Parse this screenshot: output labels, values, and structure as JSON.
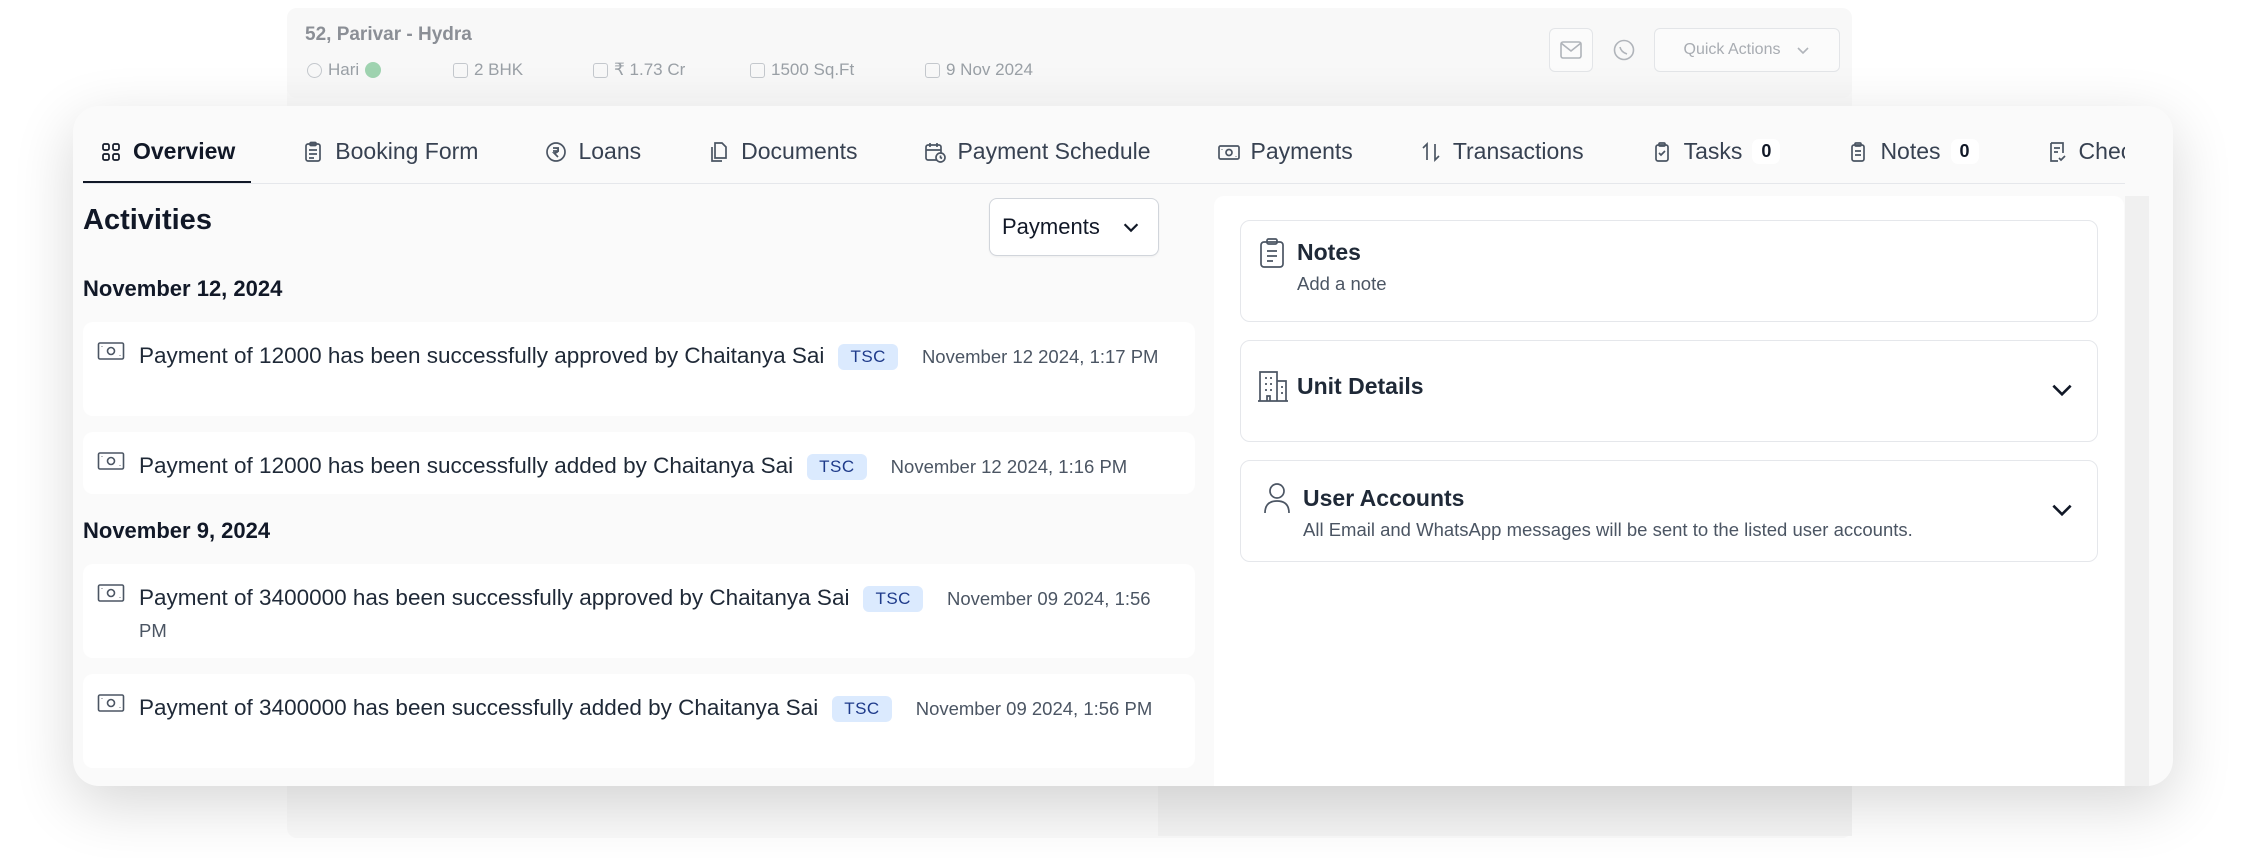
{
  "background_header": {
    "title": "52, Parivar - Hydra",
    "user": "Hari",
    "config": "2 BHK",
    "price": "₹ 1.73 Cr",
    "area": "1500 Sq.Ft",
    "date": "9 Nov 2024",
    "quick_actions": "Quick Actions"
  },
  "tabs": [
    {
      "label": "Overview",
      "icon": "grid-icon",
      "active": true
    },
    {
      "label": "Booking Form",
      "icon": "clipboard-icon"
    },
    {
      "label": "Loans",
      "icon": "rupee-circle-icon"
    },
    {
      "label": "Documents",
      "icon": "documents-icon"
    },
    {
      "label": "Payment Schedule",
      "icon": "calendar-clock-icon"
    },
    {
      "label": "Payments",
      "icon": "banknote-icon"
    },
    {
      "label": "Transactions",
      "icon": "arrows-up-down-icon"
    },
    {
      "label": "Tasks",
      "icon": "tasks-clipboard-icon",
      "count": "0"
    },
    {
      "label": "Notes",
      "icon": "notes-clipboard-icon",
      "count": "0"
    },
    {
      "label": "Checkl",
      "icon": "checklist-icon"
    }
  ],
  "activities": {
    "title": "Activities",
    "filter_value": "Payments",
    "groups": [
      {
        "date": "November 12, 2024",
        "items": [
          {
            "text": "Payment of 12000 has been successfully approved by Chaitanya Sai",
            "badge": "TSC",
            "time": "November 12 2024, 1:17 PM"
          },
          {
            "text": "Payment of 12000 has been successfully added by Chaitanya Sai",
            "badge": "TSC",
            "time": "November 12 2024, 1:16 PM"
          }
        ]
      },
      {
        "date": "November 9, 2024",
        "items": [
          {
            "text": "Payment of 3400000 has been successfully approved by Chaitanya Sai",
            "badge": "TSC",
            "time": "November 09 2024, 1:56 PM"
          },
          {
            "text": "Payment of 3400000 has been successfully added by Chaitanya Sai",
            "badge": "TSC",
            "time": "November 09 2024, 1:56 PM"
          }
        ]
      }
    ]
  },
  "side": {
    "notes_title": "Notes",
    "notes_sub": "Add a note",
    "unit_title": "Unit Details",
    "accounts_title": "User Accounts",
    "accounts_sub": "All Email and WhatsApp messages will be sent to the listed user accounts."
  }
}
